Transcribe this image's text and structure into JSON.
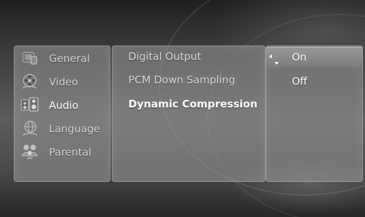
{
  "menu": {
    "items": [
      {
        "label": "General",
        "icon": "general-settings-icon"
      },
      {
        "label": "Video",
        "icon": "film-reel-icon"
      },
      {
        "label": "Audio",
        "icon": "speaker-icon"
      },
      {
        "label": "Language",
        "icon": "globe-icon"
      },
      {
        "label": "Parental",
        "icon": "family-icon"
      }
    ],
    "active": "Audio"
  },
  "submenu": {
    "items": [
      {
        "label": "Digital Output"
      },
      {
        "label": "PCM Down Sampling"
      },
      {
        "label": "Dynamic Compression"
      }
    ],
    "active": "Dynamic Compression"
  },
  "options": {
    "items": [
      {
        "label": "On"
      },
      {
        "label": "Off"
      }
    ],
    "selected": "On"
  },
  "colors": {
    "panel": "#969696",
    "highlight": "#8a8a8a",
    "active_text": "#ffffff",
    "inactive_text": "#d4d4d4"
  }
}
